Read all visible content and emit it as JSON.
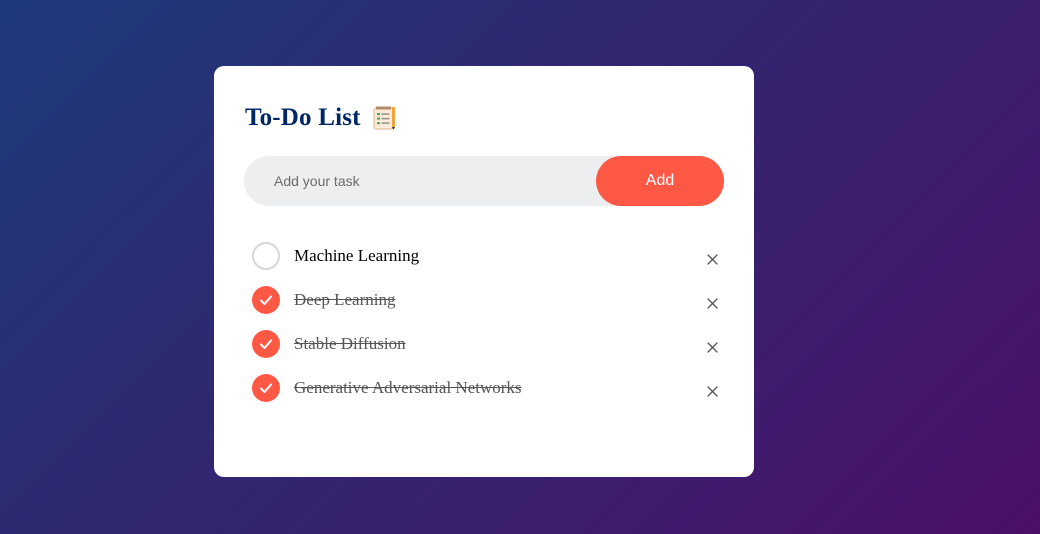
{
  "app": {
    "title": "To-Do List",
    "title_icon": "notepad-checklist-icon"
  },
  "input": {
    "placeholder": "Add your task",
    "value": ""
  },
  "add_button": {
    "label": "Add"
  },
  "tasks": [
    {
      "label": "Machine Learning",
      "checked": false,
      "delete_icon": "close-icon"
    },
    {
      "label": "Deep Learning",
      "checked": true,
      "delete_icon": "close-icon"
    },
    {
      "label": "Stable Diffusion",
      "checked": true,
      "delete_icon": "close-icon"
    },
    {
      "label": "Generative Adversarial Networks",
      "checked": true,
      "delete_icon": "close-icon"
    }
  ],
  "colors": {
    "accent": "#ff5945",
    "title": "#002765",
    "input_background": "#edeef0",
    "gradient_start": "#1e3a7d",
    "gradient_end": "#4c0f66"
  }
}
